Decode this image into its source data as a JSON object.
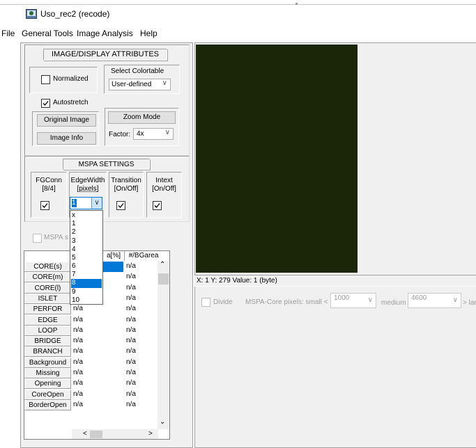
{
  "window": {
    "title": "Uso_rec2 (recode)"
  },
  "menu": [
    "File",
    "General Tools",
    "Image Analysis",
    "Help"
  ],
  "image_display": {
    "header": "IMAGE/DISPLAY ATTRIBUTES",
    "normalized_label": "Normalized",
    "normalized_checked": false,
    "autostretch_label": "Autostretch",
    "autostretch_checked": true,
    "select_colortable_label": "Select Colortable",
    "colortable_value": "User-defined",
    "original_image_label": "Original Image",
    "image_info_label": "Image Info",
    "zoom_mode_label": "Zoom Mode",
    "factor_label": "Factor:",
    "factor_value": "4x"
  },
  "mspa": {
    "header": "MSPA SETTINGS",
    "fgconn_label": "FGConn",
    "fgconn_value": "[8/4]",
    "fgconn_checked": true,
    "edgewidth_label": "EdgeWidth",
    "edgewidth_unit": "[pixels]",
    "edgewidth_value": "1",
    "transition_label": "Transition",
    "transition_value": "[On/Off]",
    "transition_checked": true,
    "intext_label": "Intext",
    "intext_value": "[On/Off]",
    "intext_checked": true,
    "mspa_check_label": "MSPA s",
    "edgewidth_options": [
      "x",
      "1",
      "2",
      "3",
      "4",
      "5",
      "6",
      "7",
      "8",
      "9",
      "10"
    ],
    "edgewidth_highlighted": "8"
  },
  "table": {
    "col_headers": [
      "a[%]",
      "#/BGarea"
    ],
    "rows": [
      {
        "label": "CORE(s)",
        "a": "",
        "b": "n/a"
      },
      {
        "label": "CORE(m)",
        "a": "",
        "b": "n/a"
      },
      {
        "label": "CORE(l)",
        "a": "",
        "b": "n/a"
      },
      {
        "label": "ISLET",
        "a": "n/a",
        "b": "n/a"
      },
      {
        "label": "PERFOR",
        "a": "n/a",
        "b": "n/a"
      },
      {
        "label": "EDGE",
        "a": "n/a",
        "b": "n/a"
      },
      {
        "label": "LOOP",
        "a": "n/a",
        "b": "n/a"
      },
      {
        "label": "BRIDGE",
        "a": "n/a",
        "b": "n/a"
      },
      {
        "label": "BRANCH",
        "a": "n/a",
        "b": "n/a"
      },
      {
        "label": "Background",
        "a": "n/a",
        "b": "n/a"
      },
      {
        "label": "Missing",
        "a": "n/a",
        "b": "n/a"
      },
      {
        "label": "Opening",
        "a": "n/a",
        "b": "n/a"
      },
      {
        "label": "CoreOpen",
        "a": "n/a",
        "b": "n/a"
      },
      {
        "label": "BorderOpen",
        "a": "n/a",
        "b": "n/a"
      }
    ]
  },
  "status": {
    "text": "X: 1  Y: 279  Value: 1 (byte)"
  },
  "core_pixels": {
    "divide_label": "Divide",
    "label": "MSPA-Core pixels: small <",
    "small_value": "1000",
    "medium_label": "medium",
    "medium_value": "4600",
    "large_label": "> lar"
  },
  "colors": {
    "image_bg": "#1b2508",
    "selection": "#0078d7",
    "panel": "#f0f0f0"
  }
}
